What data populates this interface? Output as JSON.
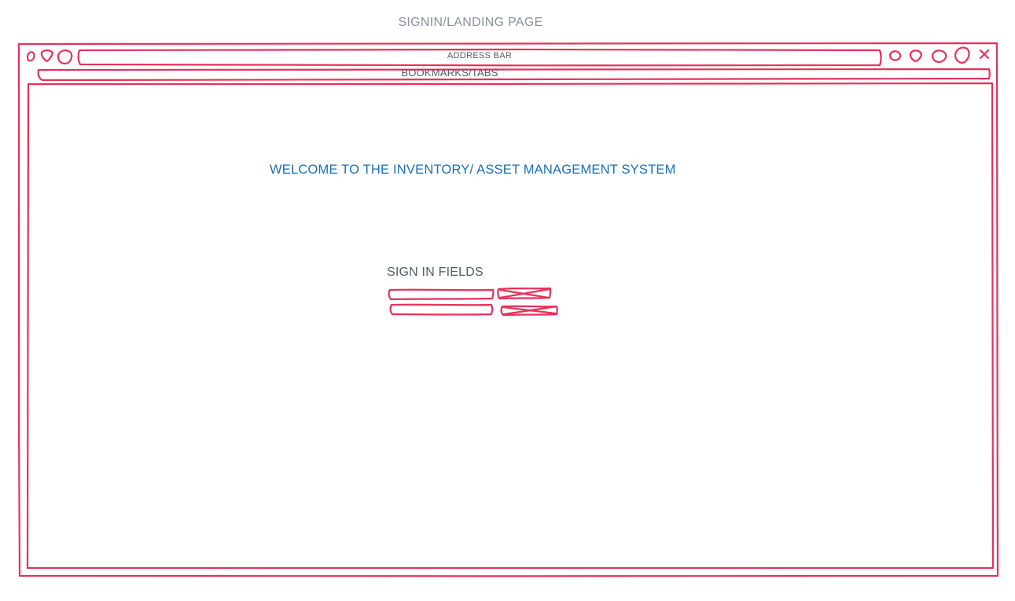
{
  "page": {
    "title": "SIGNIN/LANDING PAGE"
  },
  "browser": {
    "address_bar_label": "ADDRESS BAR",
    "bookmarks_label": "BOOKMARKS/TABS"
  },
  "content": {
    "welcome_text": "WELCOME TO THE INVENTORY/ ASSET MANAGEMENT SYSTEM",
    "signin_label": "SIGN IN FIELDS"
  },
  "colors": {
    "sketch_stroke": "#e8305a",
    "heading_blue": "#1a6fb5",
    "label_gray": "#555b61",
    "title_gray": "#8a9198"
  },
  "icons": [
    "window-control-icon",
    "close-icon",
    "image-placeholder-icon"
  ]
}
